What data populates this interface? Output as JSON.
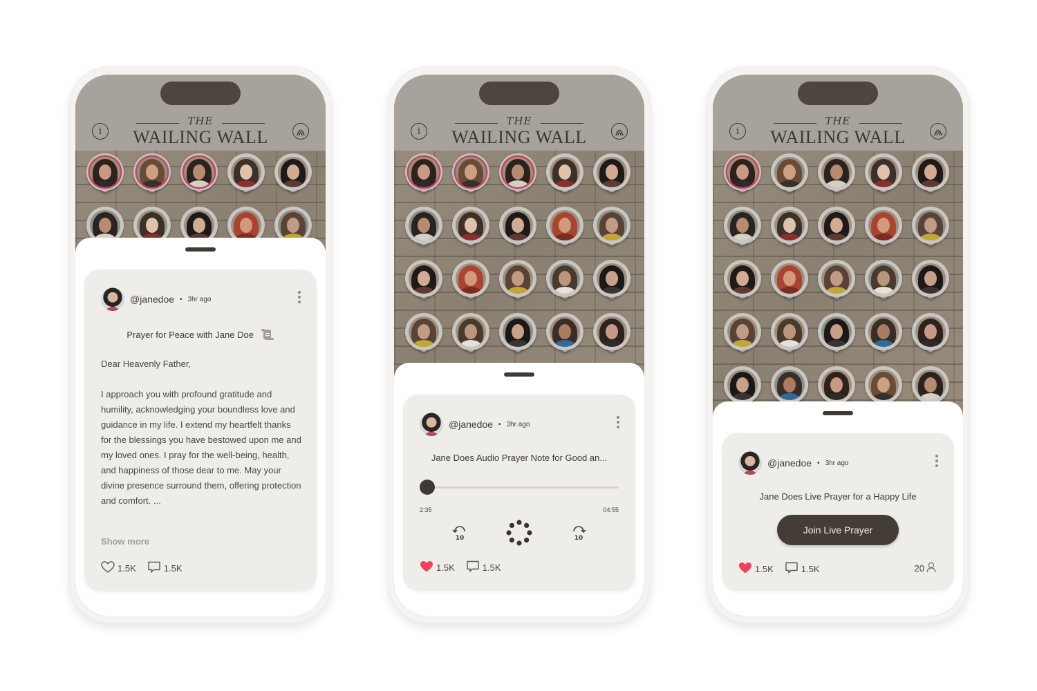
{
  "app": {
    "title_small": "THE",
    "title_big": "WAILING WALL",
    "info_icon": "info-icon",
    "wall_icon": "wall-arch-icon"
  },
  "colors": {
    "accent_dark": "#443d37",
    "like_active": "#f0415f",
    "active_ring": "#c8475e",
    "progress_track": "#e2d2bf"
  },
  "phones": [
    {
      "post": {
        "username": "@janedoe",
        "separator": "•",
        "time": "3hr ago",
        "title": "Prayer for Peace with Jane Doe",
        "title_icon": "scroll-icon",
        "greeting": "Dear Heavenly Father,",
        "body": "I approach you with profound gratitude and humility, acknowledging your boundless love and guidance in my life. I extend my heartfelt thanks for the blessings you have bestowed upon me and my loved ones. I pray for the well-being, health, and happiness of those dear to me. May your divine presence surround them, offering protection and comfort. ...",
        "show_more": "Show more",
        "likes": "1.5K",
        "comments": "1.5K",
        "liked": false
      }
    },
    {
      "post": {
        "username": "@janedoe",
        "separator": "•",
        "time": "3hr ago",
        "title": "Jane Does Audio Prayer Note for Good an...",
        "elapsed": "2:35",
        "duration": "04:55",
        "progress_fraction": 0.0,
        "rewind_label": "10",
        "forward_label": "10",
        "likes": "1.5K",
        "comments": "1.5K",
        "liked": true
      }
    },
    {
      "post": {
        "username": "@janedoe",
        "separator": "•",
        "time": "3hr ago",
        "title": "Jane Does Live Prayer for a Happy Life",
        "join_button": "Join Live Prayer",
        "likes": "1.5K",
        "comments": "1.5K",
        "participants": "20",
        "liked": true
      }
    }
  ]
}
